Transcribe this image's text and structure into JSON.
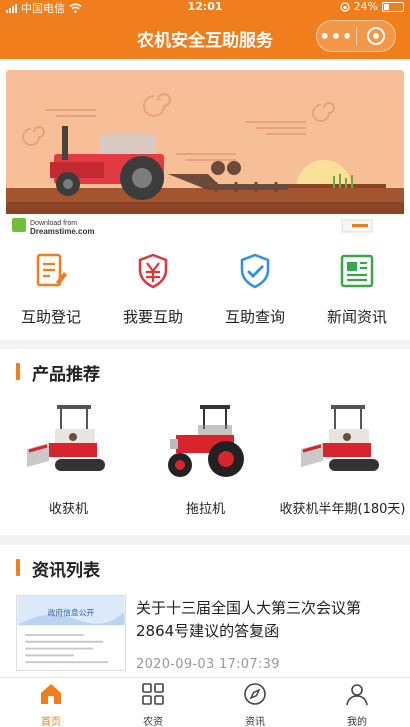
{
  "status_bar": {
    "carrier": "中国电信",
    "time": "12:01",
    "battery": "24%"
  },
  "nav": {
    "title": "农机安全互助服务",
    "more_icon": "more-dots-icon",
    "close_icon": "target-icon"
  },
  "banner": {
    "watermark_line1": "Download from",
    "watermark_line2": "Dreamstime.com"
  },
  "quick_menu": [
    {
      "label": "互助登记",
      "icon": "register-form-icon",
      "color": "#f07e1c"
    },
    {
      "label": "我要互助",
      "icon": "yuan-shield-icon",
      "color": "#d9363e"
    },
    {
      "label": "互助查询",
      "icon": "check-shield-icon",
      "color": "#2f8fe0"
    },
    {
      "label": "新闻资讯",
      "icon": "newspaper-icon",
      "color": "#3aa64a"
    }
  ],
  "products": {
    "title": "产品推荐",
    "items": [
      {
        "name": "收获机"
      },
      {
        "name": "拖拉机"
      },
      {
        "name": "收获机半年期(180天)"
      }
    ]
  },
  "news": {
    "title": "资讯列表",
    "items": [
      {
        "title": "关于十三届全国人大第三次会议第2864号建议的答复函",
        "time": "2020-09-03 17:07:39",
        "thumb_text": "政府信息公开"
      }
    ]
  },
  "tabbar": [
    {
      "label": "首页",
      "icon": "home-icon",
      "active": true
    },
    {
      "label": "农资",
      "icon": "grid-icon",
      "active": false
    },
    {
      "label": "资讯",
      "icon": "compass-icon",
      "active": false
    },
    {
      "label": "我的",
      "icon": "user-icon",
      "active": false
    }
  ],
  "colors": {
    "accent": "#f07e1c",
    "background": "#f3f3f3"
  }
}
